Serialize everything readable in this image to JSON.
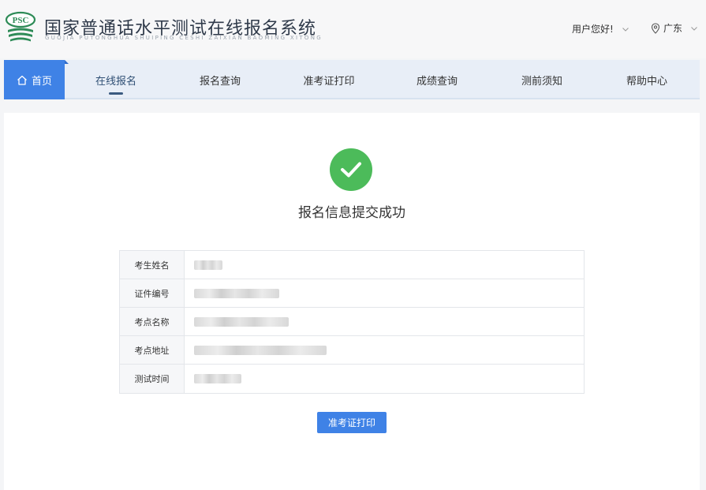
{
  "header": {
    "logo_text": "PSC",
    "title": "国家普通话水平测试在线报名系统",
    "subtitle": "GUOJIA PUTONGHUA SHUIPING CESHI ZAIXIAN BAOMING XITONG",
    "greeting": "用户您好!",
    "region": "广东"
  },
  "nav": {
    "home": "首页",
    "items": [
      {
        "label": "在线报名",
        "active": true
      },
      {
        "label": "报名查询"
      },
      {
        "label": "准考证打印"
      },
      {
        "label": "成绩查询"
      },
      {
        "label": "测前须知"
      },
      {
        "label": "帮助中心"
      }
    ]
  },
  "main": {
    "success_message": "报名信息提交成功",
    "fields": [
      {
        "label": "考生姓名"
      },
      {
        "label": "证件编号"
      },
      {
        "label": "考点名称"
      },
      {
        "label": "考点地址"
      },
      {
        "label": "测试时间"
      }
    ],
    "print_button": "准考证打印"
  },
  "colors": {
    "primary": "#3f82e6",
    "success": "#4cbb5a",
    "nav_bg": "#e8eef7"
  },
  "icons": [
    "psc-logo-icon",
    "home-icon",
    "chevron-down-icon",
    "location-pin-icon",
    "checkmark-icon"
  ]
}
